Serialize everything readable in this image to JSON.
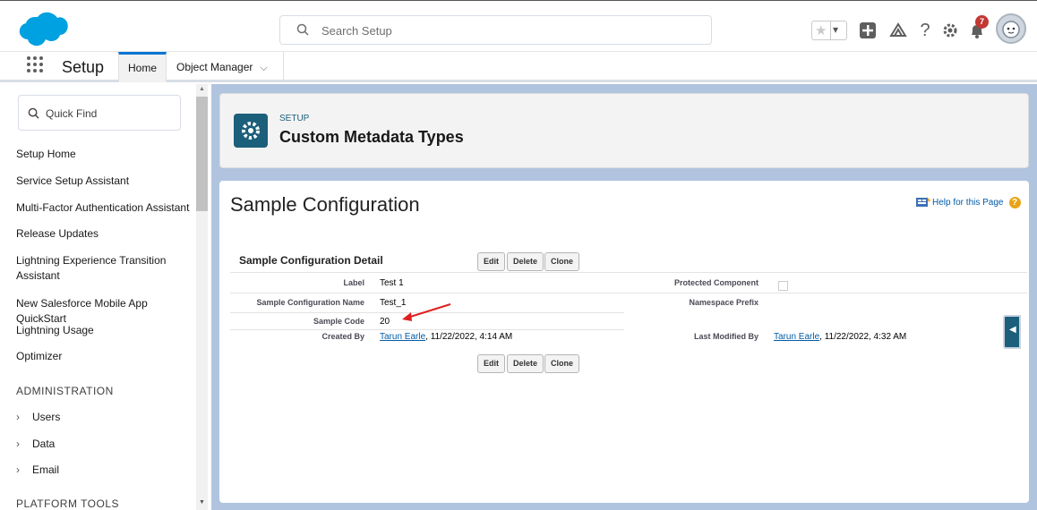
{
  "header": {
    "search_placeholder": "Search Setup",
    "notification_count": "7",
    "accent_color": "#0176d3"
  },
  "nav": {
    "app_title": "Setup",
    "tabs": [
      {
        "label": "Home",
        "active": true
      },
      {
        "label": "Object Manager",
        "has_dropdown": true
      }
    ]
  },
  "sidebar": {
    "quick_find_placeholder": "Quick Find",
    "items": [
      "Setup Home",
      "Service Setup Assistant",
      "Multi-Factor Authentication Assistant",
      "Release Updates",
      "Lightning Experience Transition Assistant",
      "New Salesforce Mobile App QuickStart",
      "Lightning Usage",
      "Optimizer"
    ],
    "section_administration": "ADMINISTRATION",
    "admin_items": [
      "Users",
      "Data",
      "Email"
    ],
    "section_platform_tools": "PLATFORM TOOLS"
  },
  "page_header": {
    "subtitle": "SETUP",
    "title": "Custom Metadata Types"
  },
  "detail": {
    "page_title": "Sample Configuration",
    "help_link": "Help for this Page",
    "section_title": "Sample Configuration Detail",
    "buttons": {
      "edit": "Edit",
      "delete": "Delete",
      "clone": "Clone"
    },
    "fields": {
      "label_label": "Label",
      "label_value": "Test 1",
      "name_label": "Sample Configuration Name",
      "name_value": "Test_1",
      "code_label": "Sample Code",
      "code_value": "20",
      "created_label": "Created By",
      "created_user": "Tarun Earle",
      "created_date": ", 11/22/2022, 4:14 AM",
      "protected_label": "Protected Component",
      "namespace_label": "Namespace Prefix",
      "modified_label": "Last Modified By",
      "modified_user": "Tarun Earle",
      "modified_date": ", 11/22/2022, 4:32 AM"
    }
  }
}
